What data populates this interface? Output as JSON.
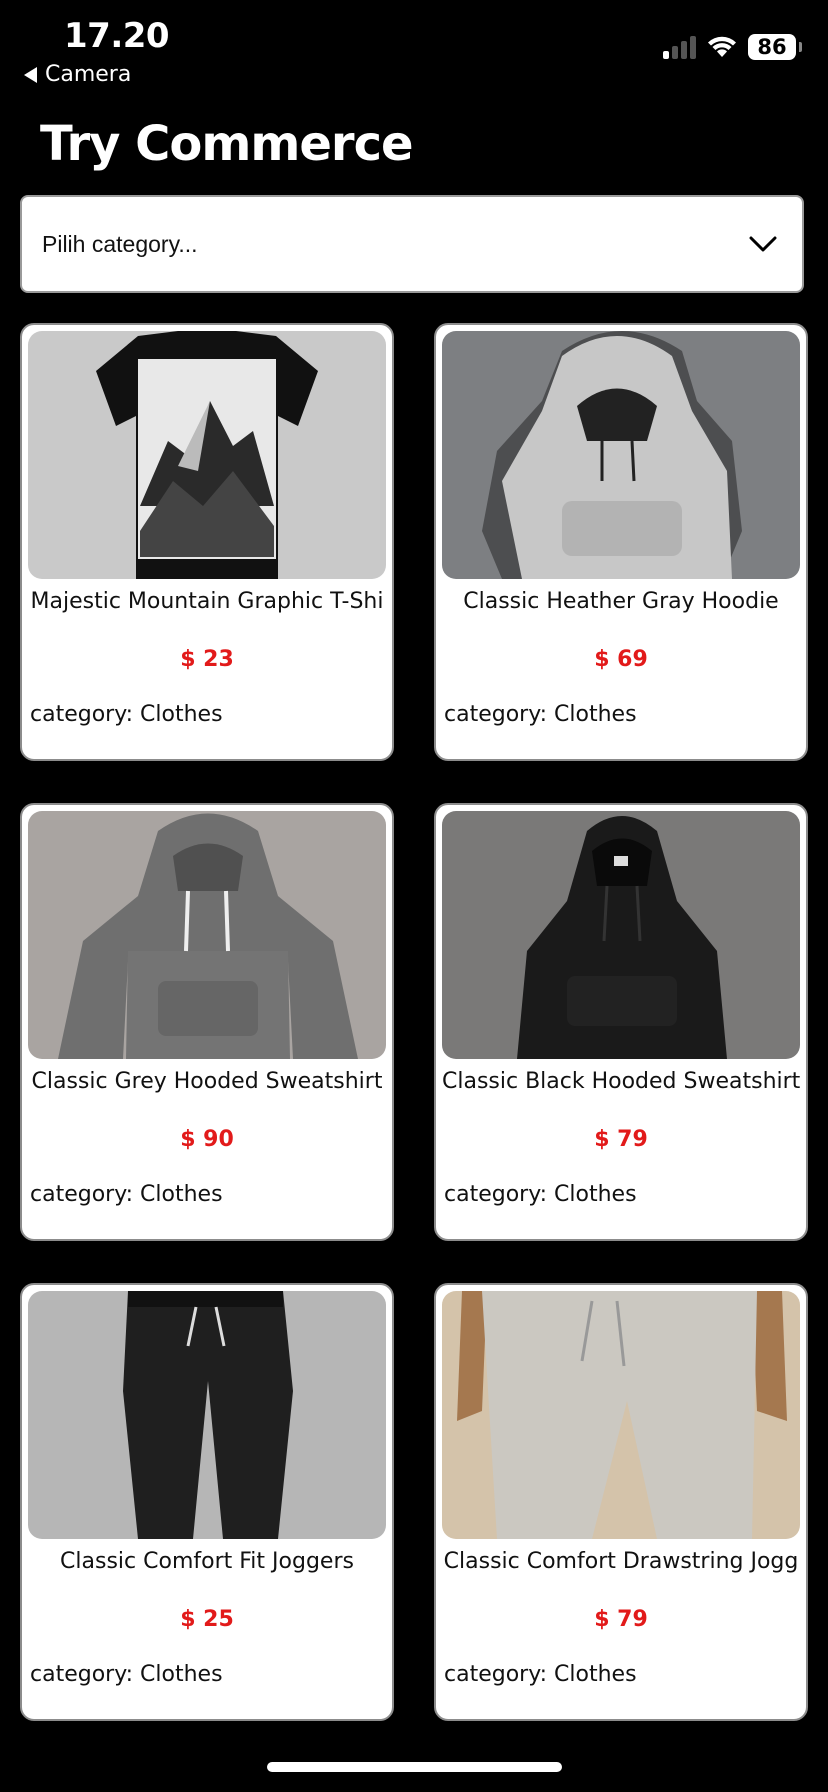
{
  "status_bar": {
    "time": "17.20",
    "back_label": "Camera",
    "battery": "86",
    "icons": [
      "signal-icon",
      "wifi-icon",
      "battery-icon"
    ]
  },
  "app": {
    "title": "Try Commerce"
  },
  "category_select": {
    "placeholder": "Pilih category...",
    "icon": "chevron-down-icon"
  },
  "products": [
    {
      "name": "Majestic Mountain Graphic T-Shi",
      "price": "$ 23",
      "category": "category: Clothes",
      "image": "black-mountain-tshirt"
    },
    {
      "name": "Classic Heather Gray Hoodie",
      "price": "$ 69",
      "category": "category: Clothes",
      "image": "light-gray-hoodie"
    },
    {
      "name": "Classic Grey Hooded Sweatshirt",
      "price": "$ 90",
      "category": "category: Clothes",
      "image": "grey-hoodie"
    },
    {
      "name": "Classic Black Hooded Sweatshirt",
      "price": "$ 79",
      "category": "category: Clothes",
      "image": "black-hoodie"
    },
    {
      "name": "Classic Comfort Fit Joggers",
      "price": "$ 25",
      "category": "category: Clothes",
      "image": "black-joggers"
    },
    {
      "name": "Classic Comfort Drawstring Jogg",
      "price": "$ 79",
      "category": "category: Clothes",
      "image": "beige-joggers"
    }
  ],
  "colors": {
    "background": "#000000",
    "price": "#e21a1a",
    "card": "#ffffff"
  }
}
